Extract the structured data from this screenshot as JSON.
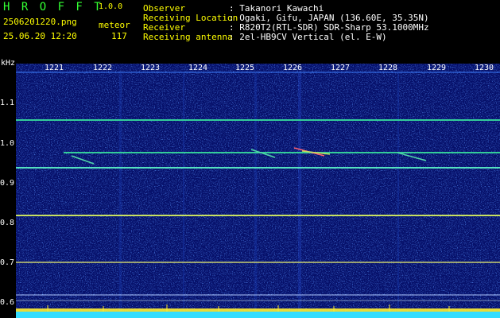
{
  "header": {
    "app_name": "H R O F F T",
    "version": "1.0.0",
    "filename": "2506201220.png",
    "datetime": "25.06.20 12:20",
    "count_label": "meteor",
    "count_value": "117",
    "fields": [
      {
        "label": "Observer",
        "value": ": Takanori Kawachi"
      },
      {
        "label": "Receiving Location",
        "value": ": Ogaki, Gifu, JAPAN (136.60E, 35.35N)"
      },
      {
        "label": "Receiver",
        "value": ": R820T2(RTL-SDR) SDR-Sharp 53.1000MHz"
      },
      {
        "label": "Receiving antenna",
        "value": ": 2el-HB9CV Vertical (el. E-W)"
      }
    ]
  },
  "spectrogram": {
    "y_unit": "kHz",
    "y_ticks": [
      "1.1",
      "1.0",
      "0.9",
      "0.8",
      "0.7",
      "0.6"
    ],
    "x_ticks": [
      "1221",
      "1222",
      "1223",
      "1224",
      "1225",
      "1226",
      "1227",
      "1228",
      "1229",
      "1230"
    ],
    "colors": {
      "background": "#06106a",
      "line": "#33cc99",
      "text": "#ffffff",
      "accent": "#ffff00"
    }
  }
}
